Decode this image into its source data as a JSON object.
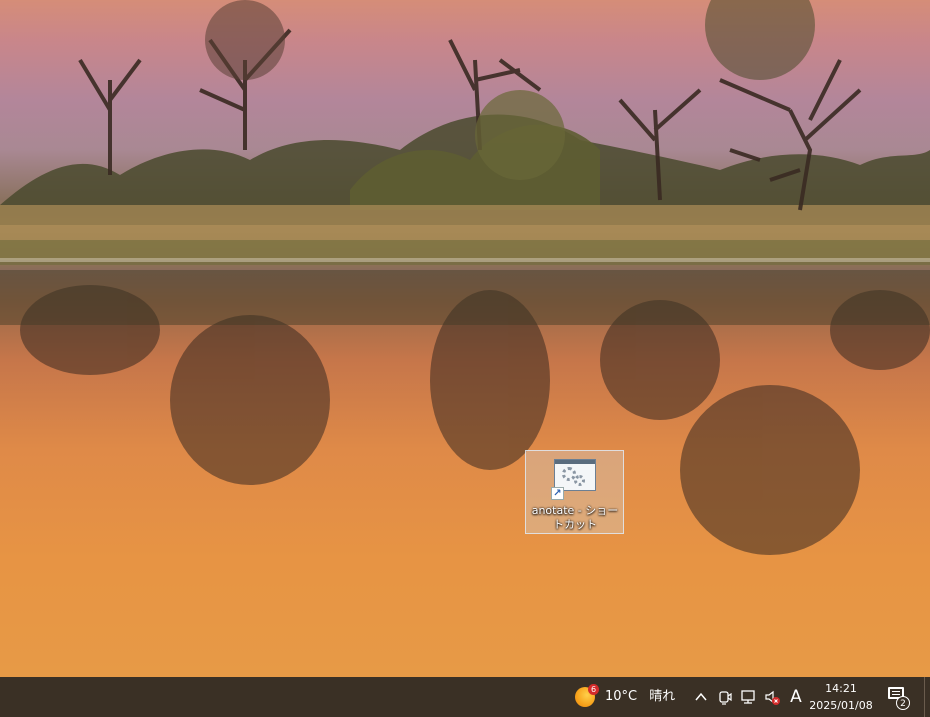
{
  "desktop": {
    "shortcut": {
      "label": "anotate - ショートカット",
      "shortcut_arrow": "↗"
    }
  },
  "taskbar": {
    "weather": {
      "temperature": "10°C",
      "condition": "晴れ",
      "badge": "6",
      "icon": "sun-icon"
    },
    "tray": {
      "overflow_icon": "^",
      "meet_icon": "camera-icon",
      "network_icon": "network-icon",
      "volume_icon": "volume-muted-icon",
      "ime_label": "A"
    },
    "clock": {
      "time": "14:21",
      "date": "2025/01/08"
    },
    "notifications": {
      "count": "2"
    }
  }
}
